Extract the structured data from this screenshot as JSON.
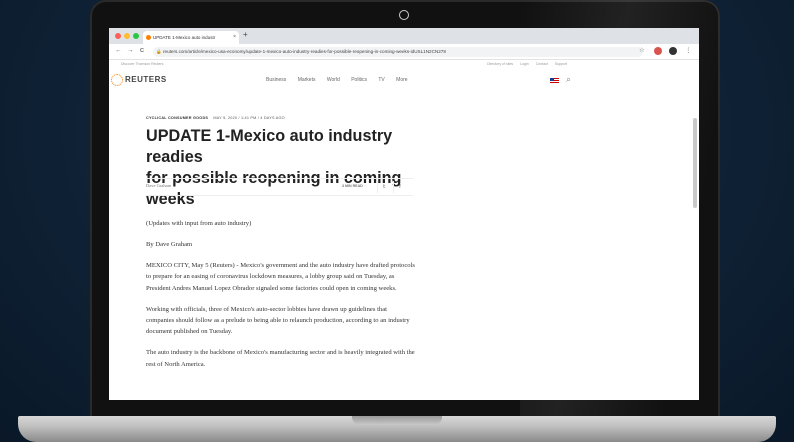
{
  "browser": {
    "tab_title": "UPDATE 1-Mexico auto industr",
    "tab_close": "×",
    "new_tab": "+",
    "url": "reuters.com/article/mexico-usa-economy/update-1-mexico-auto-industry-readies-for-possible-reopening-in-coming-weeks-idUSL1N2CN278",
    "nav": {
      "back": "←",
      "forward": "→",
      "reload": "C"
    },
    "menu": "⋮",
    "star": "☆"
  },
  "topstrip": {
    "left": "Discover Thomson Reuters",
    "links": [
      "Directory of sites",
      "Login",
      "Contact",
      "Support"
    ]
  },
  "site": {
    "logo_text": "REUTERS",
    "nav_items": [
      "Business",
      "Markets",
      "World",
      "Politics",
      "TV",
      "More"
    ]
  },
  "article": {
    "section": "CYCLICAL CONSUMER GOODS",
    "date": "MAY 5, 2020 / 1:41 PM / 4 DAYS AGO",
    "headline_line1": "UPDATE 1-Mexico auto industry readies",
    "headline_line2": "for possible reopening in coming weeks",
    "author": "Dave Graham",
    "read_time": "3 MIN READ",
    "twitter": "𝕥",
    "facebook": "f",
    "paragraphs": [
      "(Updates with input from auto industry)",
      "By Dave Graham",
      "MEXICO CITY, May 5 (Reuters) - Mexico's government and the auto industry have drafted protocols to prepare for an easing of coronavirus lockdown measures, a lobby group said on Tuesday, as President Andres Manuel Lopez Obrador signaled some factories could open in coming weeks.",
      "Working with officials, three of Mexico's auto-sector lobbies have drawn up guidelines that companies should follow as a prelude to being able to relaunch production, according to an industry document published on Tuesday.",
      "The auto industry is the backbone of Mexico's manufacturing sector and is heavily integrated with the rest of North America."
    ]
  },
  "colors": {
    "accent": "#ff8000",
    "background": "#0f2236"
  }
}
